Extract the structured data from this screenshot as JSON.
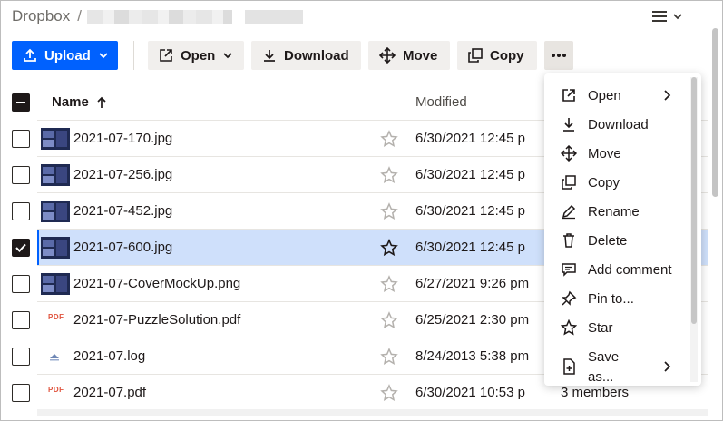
{
  "breadcrumb": {
    "root": "Dropbox",
    "separator": "/"
  },
  "toolbar": {
    "upload": "Upload",
    "open": "Open",
    "download": "Download",
    "move": "Move",
    "copy": "Copy",
    "more": "•••"
  },
  "table": {
    "headers": {
      "name": "Name",
      "modified": "Modified"
    },
    "rows": [
      {
        "name": "2021-07-170.jpg",
        "modified": "6/30/2021 12:45 p",
        "type": "image",
        "selected": false
      },
      {
        "name": "2021-07-256.jpg",
        "modified": "6/30/2021 12:45 p",
        "type": "image",
        "selected": false
      },
      {
        "name": "2021-07-452.jpg",
        "modified": "6/30/2021 12:45 p",
        "type": "image",
        "selected": false
      },
      {
        "name": "2021-07-600.jpg",
        "modified": "6/30/2021 12:45 p",
        "type": "image",
        "selected": true
      },
      {
        "name": "2021-07-CoverMockUp.png",
        "modified": "6/27/2021 9:26 pm",
        "type": "image",
        "selected": false
      },
      {
        "name": "2021-07-PuzzleSolution.pdf",
        "modified": "6/25/2021 2:30 pm",
        "type": "pdf",
        "selected": false
      },
      {
        "name": "2021-07.log",
        "modified": "8/24/2013 5:38 pm",
        "type": "log",
        "selected": false
      },
      {
        "name": "2021-07.pdf",
        "modified": "6/30/2021 10:53 p",
        "type": "pdf",
        "selected": false,
        "members": "3 members"
      }
    ],
    "pdf_icon_text": "PDF"
  },
  "context_menu": {
    "items": [
      {
        "label": "Open",
        "icon": "open-external-icon",
        "submenu": true
      },
      {
        "label": "Download",
        "icon": "download-icon"
      },
      {
        "label": "Move",
        "icon": "move-icon"
      },
      {
        "label": "Copy",
        "icon": "copy-icon"
      },
      {
        "label": "Rename",
        "icon": "pencil-icon"
      },
      {
        "label": "Delete",
        "icon": "trash-icon"
      },
      {
        "label": "Add comment",
        "icon": "comment-icon"
      },
      {
        "label": "Pin to...",
        "icon": "pin-icon"
      },
      {
        "label": "Star",
        "icon": "star-icon"
      }
    ],
    "save_as": {
      "line1": "Save",
      "line2": "as...",
      "icon": "save-as-icon",
      "submenu": true
    }
  },
  "colors": {
    "accent": "#0061fe",
    "selected_row": "#cfe0fb"
  }
}
